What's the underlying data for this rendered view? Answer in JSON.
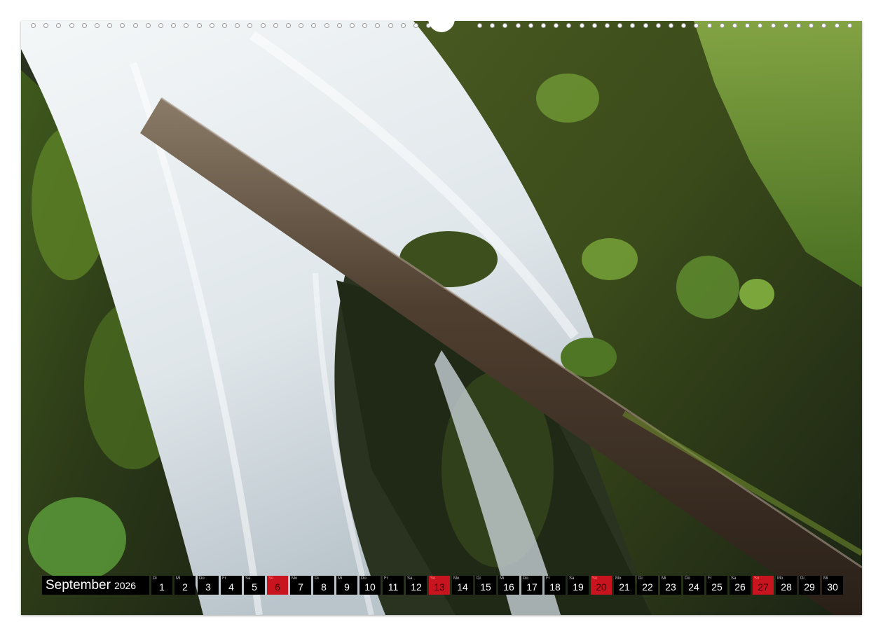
{
  "colors": {
    "bar_background": "#000000",
    "weekday_text": "#ffffff",
    "sunday_background": "#c8141e",
    "moss_green": "#5a7a2a",
    "water_white": "#eef2f4",
    "log_brown": "#4a3a2c"
  },
  "photo": {
    "subject": "waterfall-with-mossy-log"
  },
  "calendar": {
    "month": "September",
    "year": "2026",
    "days": [
      {
        "abbr": "Di",
        "num": "1",
        "sunday": false
      },
      {
        "abbr": "Mi",
        "num": "2",
        "sunday": false
      },
      {
        "abbr": "Do",
        "num": "3",
        "sunday": false
      },
      {
        "abbr": "Fr",
        "num": "4",
        "sunday": false
      },
      {
        "abbr": "Sa",
        "num": "5",
        "sunday": false
      },
      {
        "abbr": "So",
        "num": "6",
        "sunday": true
      },
      {
        "abbr": "Mo",
        "num": "7",
        "sunday": false
      },
      {
        "abbr": "Di",
        "num": "8",
        "sunday": false
      },
      {
        "abbr": "Mi",
        "num": "9",
        "sunday": false
      },
      {
        "abbr": "Do",
        "num": "10",
        "sunday": false
      },
      {
        "abbr": "Fr",
        "num": "11",
        "sunday": false
      },
      {
        "abbr": "Sa",
        "num": "12",
        "sunday": false
      },
      {
        "abbr": "So",
        "num": "13",
        "sunday": true
      },
      {
        "abbr": "Mo",
        "num": "14",
        "sunday": false
      },
      {
        "abbr": "Di",
        "num": "15",
        "sunday": false
      },
      {
        "abbr": "Mi",
        "num": "16",
        "sunday": false
      },
      {
        "abbr": "Do",
        "num": "17",
        "sunday": false
      },
      {
        "abbr": "Fr",
        "num": "18",
        "sunday": false
      },
      {
        "abbr": "Sa",
        "num": "19",
        "sunday": false
      },
      {
        "abbr": "So",
        "num": "20",
        "sunday": true
      },
      {
        "abbr": "Mo",
        "num": "21",
        "sunday": false
      },
      {
        "abbr": "Di",
        "num": "22",
        "sunday": false
      },
      {
        "abbr": "Mi",
        "num": "23",
        "sunday": false
      },
      {
        "abbr": "Do",
        "num": "24",
        "sunday": false
      },
      {
        "abbr": "Fr",
        "num": "25",
        "sunday": false
      },
      {
        "abbr": "Sa",
        "num": "26",
        "sunday": false
      },
      {
        "abbr": "So",
        "num": "27",
        "sunday": true
      },
      {
        "abbr": "Mo",
        "num": "28",
        "sunday": false
      },
      {
        "abbr": "Di",
        "num": "29",
        "sunday": false
      },
      {
        "abbr": "Mi",
        "num": "30",
        "sunday": false
      }
    ]
  }
}
